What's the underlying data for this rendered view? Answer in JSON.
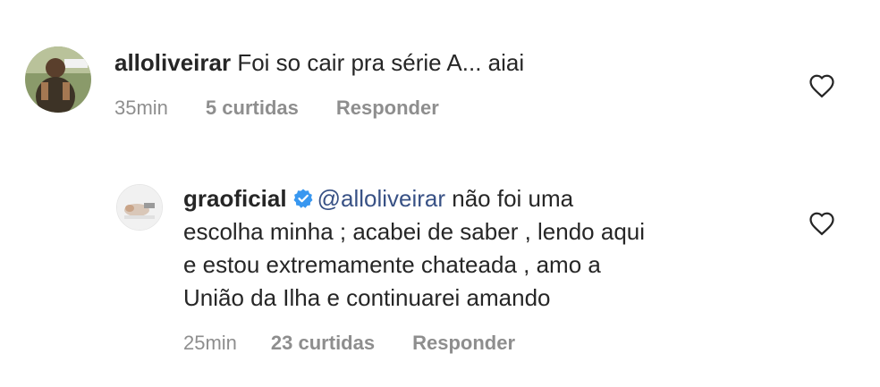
{
  "comments": [
    {
      "username": "alloliveirar",
      "text": "Foi so cair pra série A... aiai",
      "time": "35min",
      "likes": "5 curtidas",
      "reply_label": "Responder",
      "like_icon": "heart-outline-icon"
    },
    {
      "username": "graoficial",
      "verified": true,
      "mention": "@alloliveirar",
      "text_line1": "não foi uma",
      "text_line2": "escolha minha ; acabei de saber , lendo aqui",
      "text_line3": "e estou extremamente chateada , amo a",
      "text_line4": "União da Ilha e continuarei amando",
      "time": "25min",
      "likes": "23 curtidas",
      "reply_label": "Responder",
      "like_icon": "heart-outline-icon"
    }
  ],
  "colors": {
    "text": "#262626",
    "meta": "#8e8e8e",
    "mention": "#385185",
    "verified": "#3897f0"
  }
}
